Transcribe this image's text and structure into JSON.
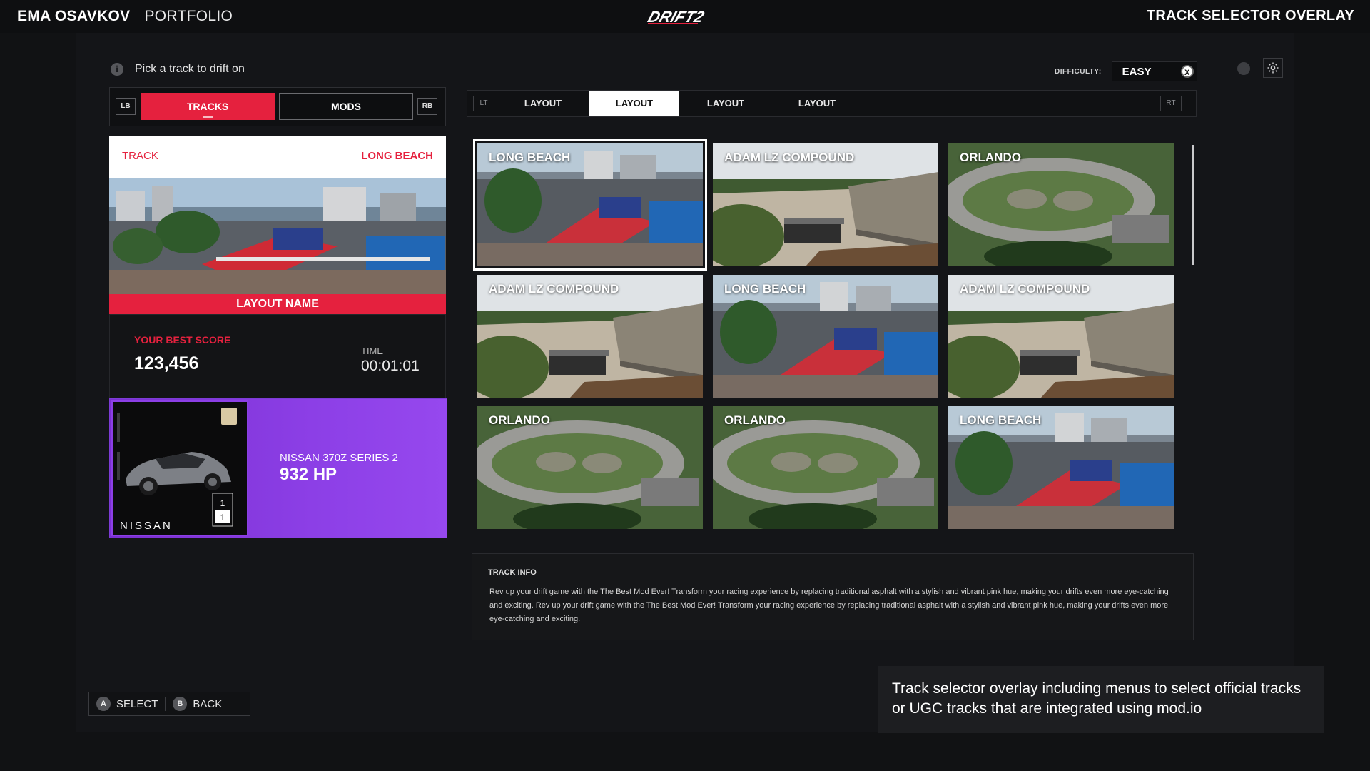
{
  "header": {
    "author": "EMA OSAVKOV",
    "section": "PORTFOLIO",
    "logo_text": "DRIFT2",
    "overlay_title": "TRACK SELECTOR OVERLAY"
  },
  "hint": {
    "text": "Pick a track to drift on"
  },
  "difficulty": {
    "label": "DIFFICULTY:",
    "value": "EASY",
    "clear_button": "X"
  },
  "left_tabs": {
    "lb": "LB",
    "rb": "RB",
    "tabs": [
      {
        "label": "TRACKS",
        "active": true
      },
      {
        "label": "MODS",
        "active": false
      }
    ]
  },
  "track_card": {
    "label": "TRACK",
    "name": "LONG BEACH",
    "layout_name": "LAYOUT NAME"
  },
  "score": {
    "best_label": "YOUR BEST SCORE",
    "best_value": "123,456",
    "time_label": "TIME",
    "time_value": "00:01:01"
  },
  "car": {
    "brand": "NISSAN",
    "model": "NISSAN 370Z SERIES 2",
    "hp": "932 HP",
    "rank_top": "1",
    "rank_bottom": "1"
  },
  "layout_tabs": {
    "lt": "LT",
    "rt": "RT",
    "tabs": [
      {
        "label": "LAYOUT",
        "active": false
      },
      {
        "label": "LAYOUT",
        "active": true
      },
      {
        "label": "LAYOUT",
        "active": false
      },
      {
        "label": "LAYOUT",
        "active": false
      }
    ]
  },
  "tracks": [
    {
      "name": "LONG BEACH",
      "type": "city",
      "selected": true
    },
    {
      "name": "ADAM LZ COMPOUND",
      "type": "compound",
      "selected": false
    },
    {
      "name": "ORLANDO",
      "type": "oval",
      "selected": false
    },
    {
      "name": "ADAM LZ COMPOUND",
      "type": "compound",
      "selected": false
    },
    {
      "name": "LONG BEACH",
      "type": "city",
      "selected": false
    },
    {
      "name": "ADAM LZ COMPOUND",
      "type": "compound",
      "selected": false
    },
    {
      "name": "ORLANDO",
      "type": "oval",
      "selected": false
    },
    {
      "name": "ORLANDO",
      "type": "oval",
      "selected": false
    },
    {
      "name": "LONG BEACH",
      "type": "city",
      "selected": false
    }
  ],
  "track_info": {
    "title": "TRACK INFO",
    "text": "Rev up your drift game with the The Best Mod Ever! Transform your racing experience by replacing traditional asphalt with a stylish and vibrant pink hue, making your drifts even more eye-catching and exciting. Rev up your drift game with the The Best Mod Ever! Transform your racing experience by replacing traditional asphalt with a stylish and vibrant pink hue, making your drifts even more eye-catching and exciting."
  },
  "controls": [
    {
      "button": "A",
      "label": "SELECT"
    },
    {
      "button": "B",
      "label": "BACK"
    }
  ],
  "caption": "Track selector overlay including menus to select official tracks or UGC tracks that are integrated using mod.io",
  "colors": {
    "accent": "#e5213e",
    "car_card": "#8c3fe6",
    "background": "#141518"
  }
}
